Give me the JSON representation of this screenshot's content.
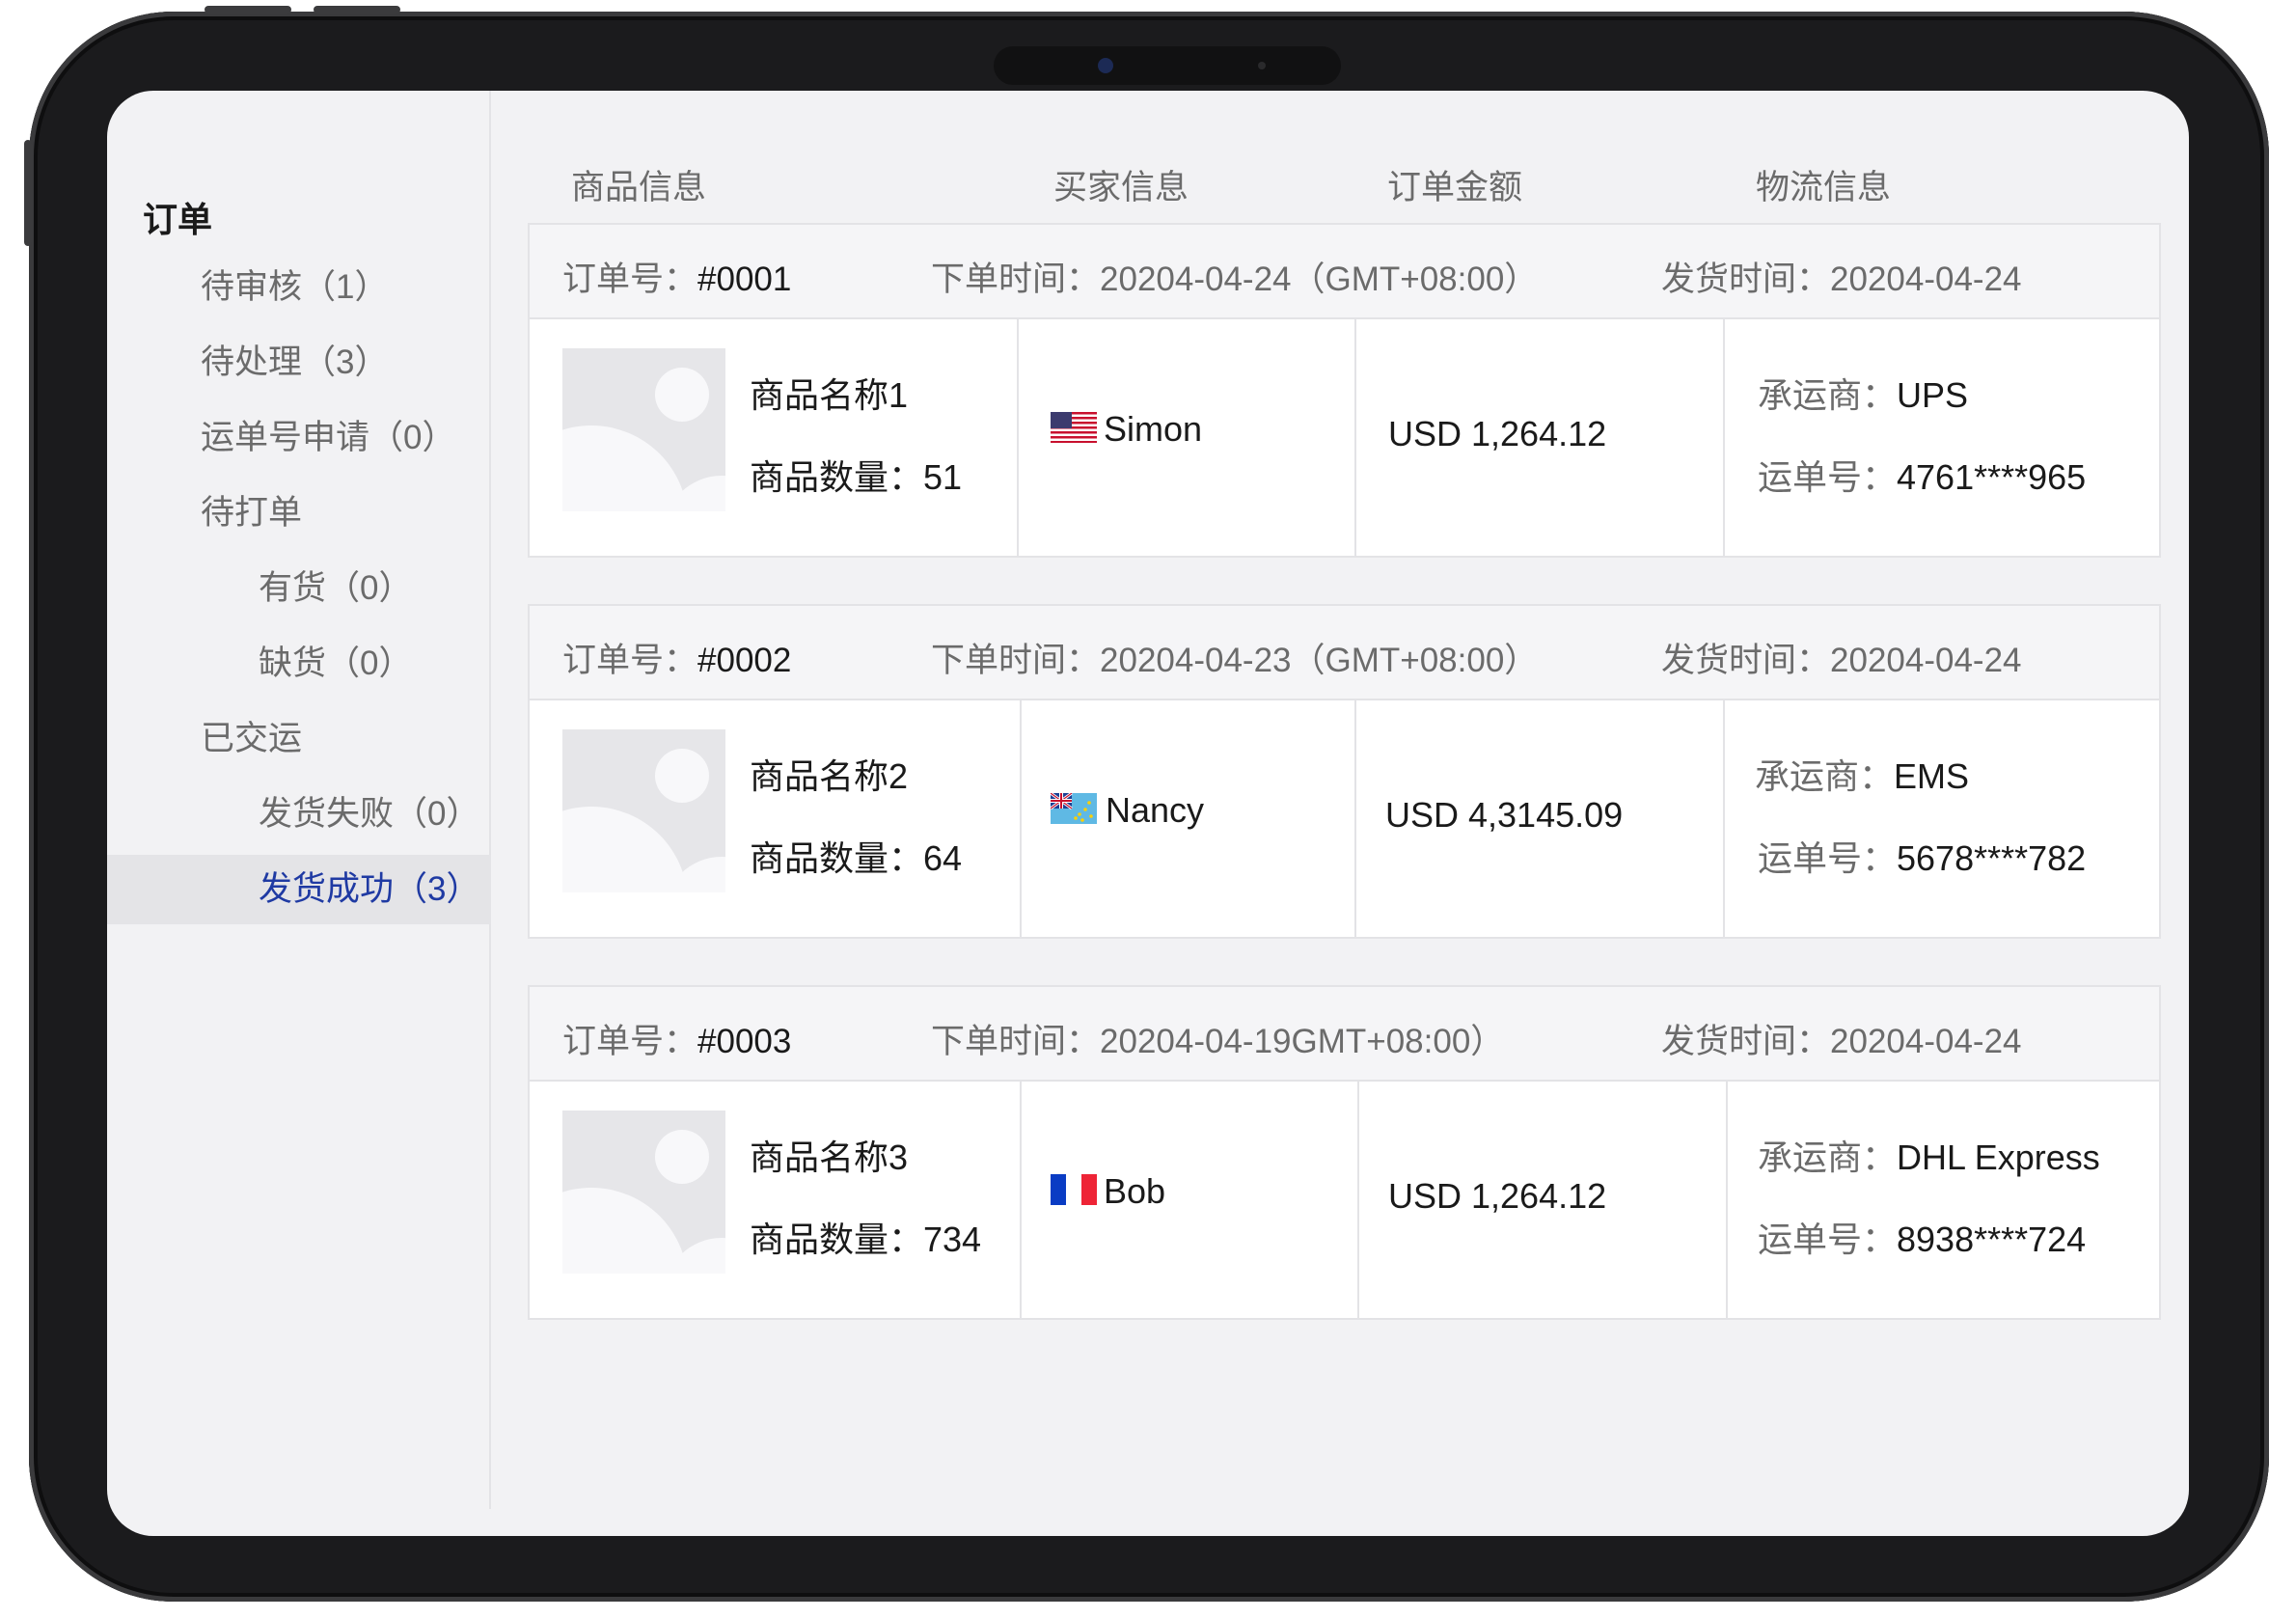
{
  "sidebar": {
    "title": "订单",
    "items": [
      {
        "label": "待审核（1）"
      },
      {
        "label": "待处理（3）"
      },
      {
        "label": "运单号申请（0）"
      },
      {
        "label": "待打单"
      },
      {
        "label": "有货（0）"
      },
      {
        "label": "缺货（0）"
      },
      {
        "label": "已交运"
      },
      {
        "label": "发货失败（0）"
      },
      {
        "label": "发货成功（3）",
        "active": true
      }
    ]
  },
  "columns": [
    "商品信息",
    "买家信息",
    "订单金额",
    "物流信息"
  ],
  "labels": {
    "order_no": "订单号：",
    "order_time": "下单时间：",
    "ship_time": "发货时间：",
    "qty": "商品数量：",
    "carrier": "承运商：",
    "tracking": "运单号："
  },
  "orders": [
    {
      "id": "#0001",
      "order_time": "20204-04-24（GMT+08:00）",
      "ship_time": "20204-04-24",
      "product_name": "商品名称1",
      "qty": "51",
      "buyer": "Simon",
      "buyer_flag": "us-flag-icon",
      "amount": "USD 1,264.12",
      "carrier": "UPS",
      "tracking": "4761****965"
    },
    {
      "id": "#0002",
      "order_time": "20204-04-23（GMT+08:00）",
      "ship_time": "20204-04-24",
      "product_name": "商品名称2",
      "qty": "64",
      "buyer": "Nancy",
      "buyer_flag": "tuvalu-flag-icon",
      "amount": "USD 4,3145.09",
      "carrier": "EMS",
      "tracking": "5678****782"
    },
    {
      "id": "#0003",
      "order_time": "20204-04-19GMT+08:00）",
      "ship_time": "20204-04-24",
      "product_name": "商品名称3",
      "qty": "734",
      "buyer": "Bob",
      "buyer_flag": "france-flag-icon",
      "amount": "USD 1,264.12",
      "carrier": "DHL Express",
      "tracking": "8938****724"
    }
  ],
  "colors": {
    "active_text": "#1f3aa3",
    "active_bg": "#e4e4e7",
    "muted_text": "#6b6b6b",
    "border": "#e3e3e6"
  }
}
